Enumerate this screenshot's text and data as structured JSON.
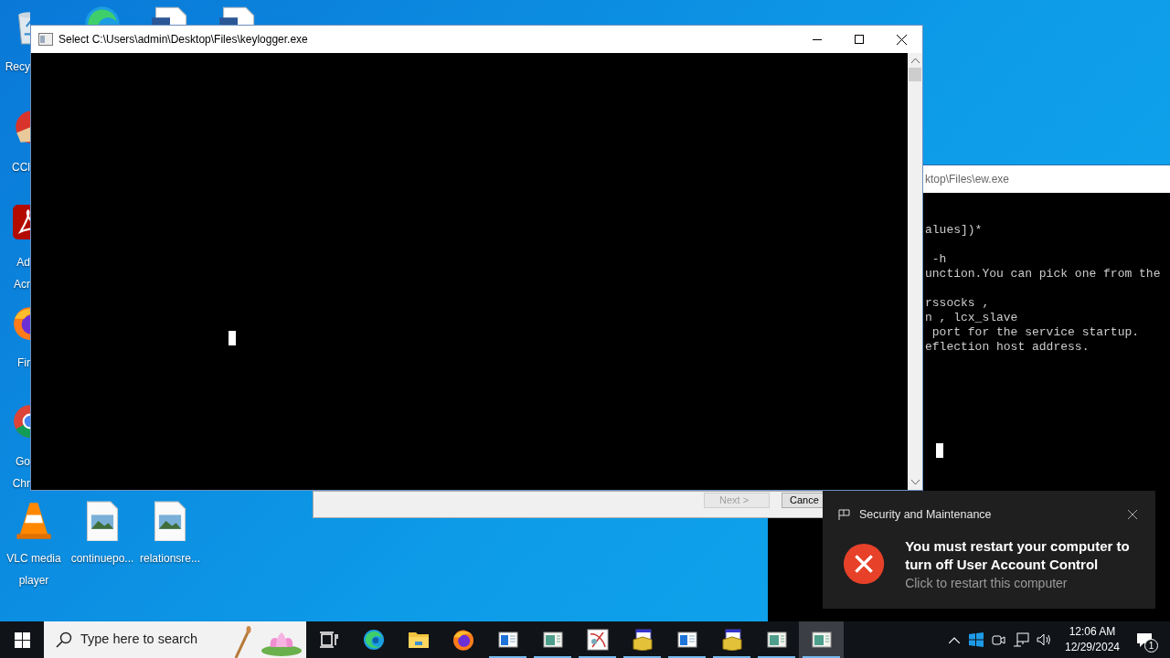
{
  "desktop_icons": [
    {
      "kind": "recycle-bin",
      "lines": [
        "Recy"
      ]
    },
    {
      "kind": "edge"
    },
    {
      "kind": "document"
    },
    {
      "kind": "document"
    },
    {
      "kind": "ccleaner",
      "lines": [
        "CCl"
      ]
    },
    {
      "kind": "acrobat",
      "lines": [
        "Ad",
        "Acr"
      ]
    },
    {
      "kind": "firefox",
      "lines": [
        "Fir"
      ]
    },
    {
      "kind": "chrome",
      "lines": [
        "Go",
        "Chr"
      ]
    },
    {
      "kind": "vlc",
      "lines": [
        "VLC media",
        "player"
      ]
    },
    {
      "kind": "image-file",
      "lines": [
        "continuepo..."
      ]
    },
    {
      "kind": "image-file",
      "lines": [
        "relationsre..."
      ]
    }
  ],
  "back_console": {
    "title": "ktop\\Files\\ew.exe",
    "paragraphs": [
      [
        "alues])*"
      ],
      [
        " -h",
        "unction.You can pick one from the"
      ],
      [
        "rssocks ,",
        "n , lcx_slave",
        " port for the service startup.",
        "eflection host address."
      ]
    ]
  },
  "wizard_dialog": {
    "buttons": [
      {
        "label": "Next >",
        "disabled": true
      },
      {
        "label": "Cance",
        "disabled": false
      }
    ]
  },
  "main_console": {
    "title": "Select C:\\Users\\admin\\Desktop\\Files\\keylogger.exe"
  },
  "notification": {
    "app": "Security and Maintenance",
    "title": "You must restart your computer to turn off User Account Control",
    "body": "Click to restart this computer"
  },
  "taskbar": {
    "search_placeholder": "Type here to search",
    "apps": [
      {
        "kind": "task-view",
        "running": false,
        "selected": false
      },
      {
        "kind": "edge",
        "running": false,
        "selected": false
      },
      {
        "kind": "explorer",
        "running": false,
        "selected": false
      },
      {
        "kind": "firefox",
        "running": false,
        "selected": false
      },
      {
        "kind": "window-blue",
        "running": true,
        "selected": false
      },
      {
        "kind": "window-green",
        "running": true,
        "selected": false
      },
      {
        "kind": "paint",
        "running": true,
        "selected": false
      },
      {
        "kind": "installer",
        "running": true,
        "selected": false
      },
      {
        "kind": "window-blue",
        "running": true,
        "selected": false
      },
      {
        "kind": "installer",
        "running": true,
        "selected": false
      },
      {
        "kind": "window-green",
        "running": true,
        "selected": false
      },
      {
        "kind": "window-green",
        "running": true,
        "selected": true
      }
    ],
    "time": "12:06 AM",
    "date": "12/29/2024",
    "notification_count": "1"
  }
}
